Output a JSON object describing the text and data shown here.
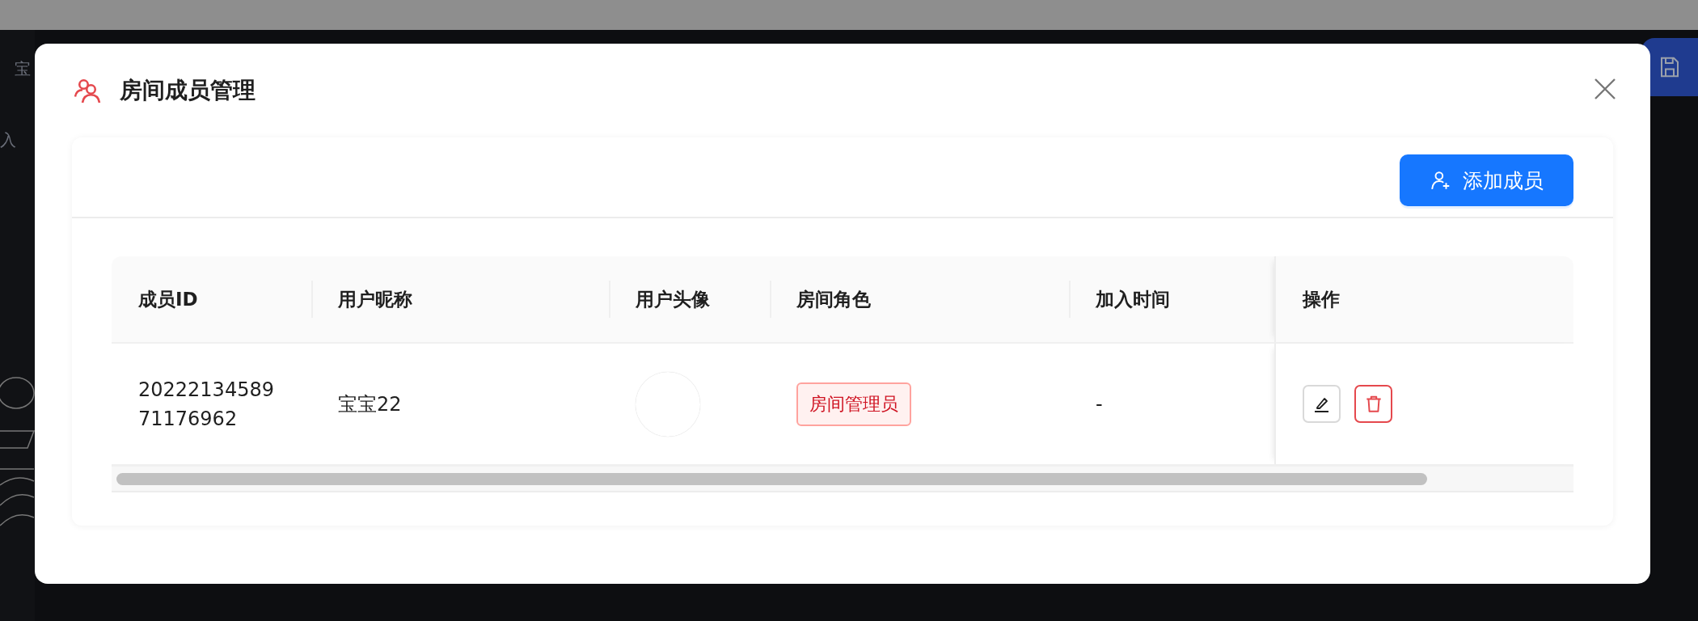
{
  "background": {
    "labels": [
      "宝",
      "入"
    ]
  },
  "dialog": {
    "title": "房间成员管理",
    "add_button": "添加成员",
    "table": {
      "columns": [
        "成员ID",
        "用户昵称",
        "用户头像",
        "房间角色",
        "加入时间",
        "操作"
      ],
      "rows": [
        {
          "member_id": "2022213458971176962",
          "nickname": "宝宝22",
          "role": "房间管理员",
          "joined": "-"
        }
      ]
    }
  }
}
